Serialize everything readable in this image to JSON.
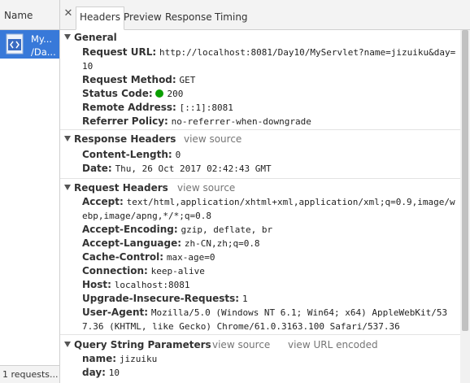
{
  "request_list": {
    "header": "Name",
    "selected": {
      "line1": "My...",
      "line2": "/Da..."
    },
    "footer": "1 requests..."
  },
  "tabs": [
    "Headers",
    "Preview",
    "Response",
    "Timing"
  ],
  "general": {
    "title": "General",
    "rows": [
      {
        "k": "Request URL:",
        "v": "http://localhost:8081/Day10/MyServlet?name=jizuiku&day=10"
      },
      {
        "k": "Request Method:",
        "v": "GET"
      },
      {
        "k": "Status Code:",
        "v": "200"
      },
      {
        "k": "Remote Address:",
        "v": "[::1]:8081"
      },
      {
        "k": "Referrer Policy:",
        "v": "no-referrer-when-downgrade"
      }
    ]
  },
  "response_headers": {
    "title": "Response Headers",
    "view_source": "view source",
    "rows": [
      {
        "k": "Content-Length:",
        "v": "0"
      },
      {
        "k": "Date:",
        "v": "Thu, 26 Oct 2017 02:42:43 GMT"
      }
    ]
  },
  "request_headers": {
    "title": "Request Headers",
    "view_source": "view source",
    "rows": [
      {
        "k": "Accept:",
        "v": "text/html,application/xhtml+xml,application/xml;q=0.9,image/webp,image/apng,*/*;q=0.8"
      },
      {
        "k": "Accept-Encoding:",
        "v": "gzip, deflate, br"
      },
      {
        "k": "Accept-Language:",
        "v": "zh-CN,zh;q=0.8"
      },
      {
        "k": "Cache-Control:",
        "v": "max-age=0"
      },
      {
        "k": "Connection:",
        "v": "keep-alive"
      },
      {
        "k": "Host:",
        "v": "localhost:8081"
      },
      {
        "k": "Upgrade-Insecure-Requests:",
        "v": "1"
      },
      {
        "k": "User-Agent:",
        "v": "Mozilla/5.0 (Windows NT 6.1; Win64; x64) AppleWebKit/537.36 (KHTML, like Gecko) Chrome/61.0.3163.100 Safari/537.36"
      }
    ]
  },
  "query_params": {
    "title": "Query String Parameters",
    "view_source": "view source",
    "view_url_encoded": "view URL encoded",
    "rows": [
      {
        "k": "name:",
        "v": "jizuiku"
      },
      {
        "k": "day:",
        "v": "10"
      }
    ]
  },
  "colors": {
    "selected_bg": "#3879d9",
    "status_ok": "#0a9e01"
  }
}
